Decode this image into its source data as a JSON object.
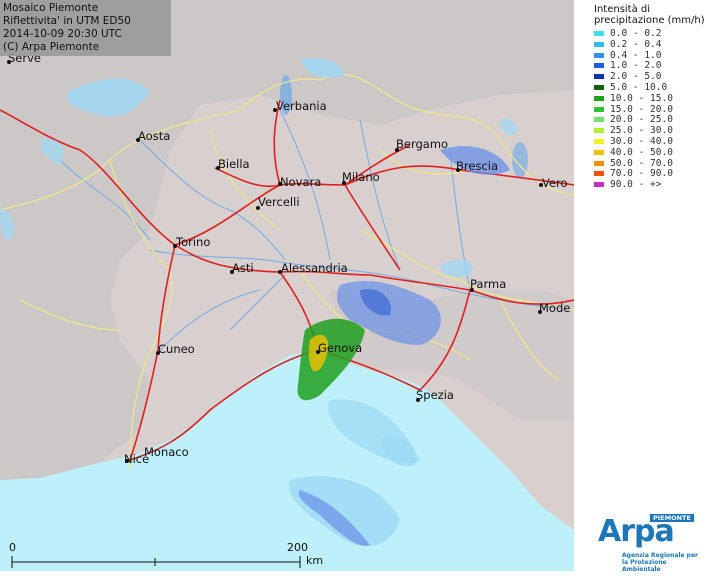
{
  "header": {
    "line1": "Mosaico Piemonte",
    "line2": "Riflettivita' in UTM ED50",
    "line3": "2014-10-09 20:30 UTC",
    "line4": "(C) Arpa Piemonte"
  },
  "legend": {
    "title_line1": "Intensità di",
    "title_line2": "precipitazione (mm/h)",
    "items": [
      {
        "range": "0.0  -  0.2",
        "color": "#40e0f0"
      },
      {
        "range": "0.2  -  0.4",
        "color": "#38b8f0"
      },
      {
        "range": "0.4  -  1.0",
        "color": "#3090e8"
      },
      {
        "range": "1.0  -  2.0",
        "color": "#2060e0"
      },
      {
        "range": "2.0  -  5.0",
        "color": "#1030b0"
      },
      {
        "range": "5.0  -  10.0",
        "color": "#106010"
      },
      {
        "range": "10.0  -  15.0",
        "color": "#20a020"
      },
      {
        "range": "15.0  -  20.0",
        "color": "#30c030"
      },
      {
        "range": "20.0  -  25.0",
        "color": "#70e070"
      },
      {
        "range": "25.0  -  30.0",
        "color": "#b0f030"
      },
      {
        "range": "30.0  -  40.0",
        "color": "#f0f020"
      },
      {
        "range": "40.0  -  50.0",
        "color": "#f0c000"
      },
      {
        "range": "50.0  -  70.0",
        "color": "#f09000"
      },
      {
        "range": "70.0  -  90.0",
        "color": "#f05000"
      },
      {
        "range": "90.0  -  +>",
        "color": "#c030c0"
      }
    ]
  },
  "cities": [
    {
      "name": "Aosta"
    },
    {
      "name": "Verbania"
    },
    {
      "name": "Biella"
    },
    {
      "name": "Novara"
    },
    {
      "name": "Milano"
    },
    {
      "name": "Bergamo"
    },
    {
      "name": "Brescia"
    },
    {
      "name": "Vercelli"
    },
    {
      "name": "Torino"
    },
    {
      "name": "Asti"
    },
    {
      "name": "Alessandria"
    },
    {
      "name": "Parma"
    },
    {
      "name": "Cuneo"
    },
    {
      "name": "Genova"
    },
    {
      "name": "Spezia"
    },
    {
      "name": "Monaco"
    },
    {
      "name": "Nice"
    },
    {
      "name": "Serve"
    },
    {
      "name": "Vero"
    },
    {
      "name": "Mode"
    }
  ],
  "scalebar": {
    "start": "0",
    "end": "200",
    "unit": "km"
  },
  "logo": {
    "name": "Arpa",
    "badge": "PIEMONTE",
    "subtitle": "Agenzia Regionale per la Protezione Ambientale"
  },
  "colors": {
    "land": "#d9cfcf",
    "sea": "#bff0f8",
    "roads": "#e02020",
    "borders": "#f0e890",
    "rivers": "#6aa8e8"
  }
}
